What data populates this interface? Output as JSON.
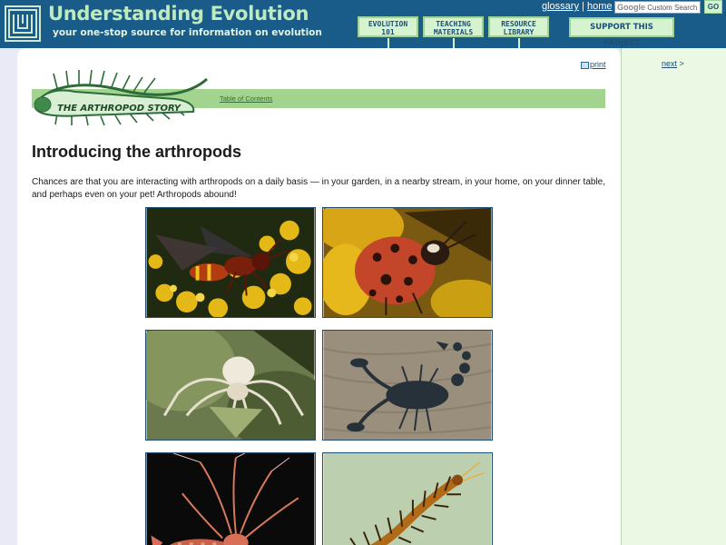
{
  "header": {
    "title": "Understanding Evolution",
    "tagline": "your one-stop source for information on evolution",
    "nav": [
      {
        "line1": "EVOLUTION",
        "line2": "101"
      },
      {
        "line1": "TEACHING",
        "line2": "MATERIALS"
      },
      {
        "line1": "RESOURCE",
        "line2": "LIBRARY"
      }
    ],
    "support_label": "SUPPORT THIS PROJECT",
    "links": {
      "glossary": "glossary",
      "separator": "|",
      "home": "home"
    },
    "search": {
      "brand": "Google",
      "placeholder": "Custom Search"
    },
    "go_label": "GO"
  },
  "main": {
    "print_label": "print",
    "banner_label": "THE ARTHROPOD STORY",
    "toc_label": "Table of Contents",
    "title": "Introducing the arthropods",
    "intro": "Chances are that you are interacting with arthropods on a daily basis — in your garden, in a nearby stream, in your home, on your dinner table, and perhaps even on your pet! Arthropods abound!"
  },
  "sidebar": {
    "next_label": "next",
    "next_arrow": ">"
  },
  "photos": [
    "wasp",
    "ladybug",
    "crab-spider",
    "scorpion",
    "crayfish",
    "centipede"
  ],
  "colors": {
    "header_bg": "#1a5c89",
    "title_green": "#bfe9bf",
    "nav_bg": "#d6f3d0",
    "banner_green": "#a3d48f",
    "right_panel": "#eaf8e4"
  }
}
